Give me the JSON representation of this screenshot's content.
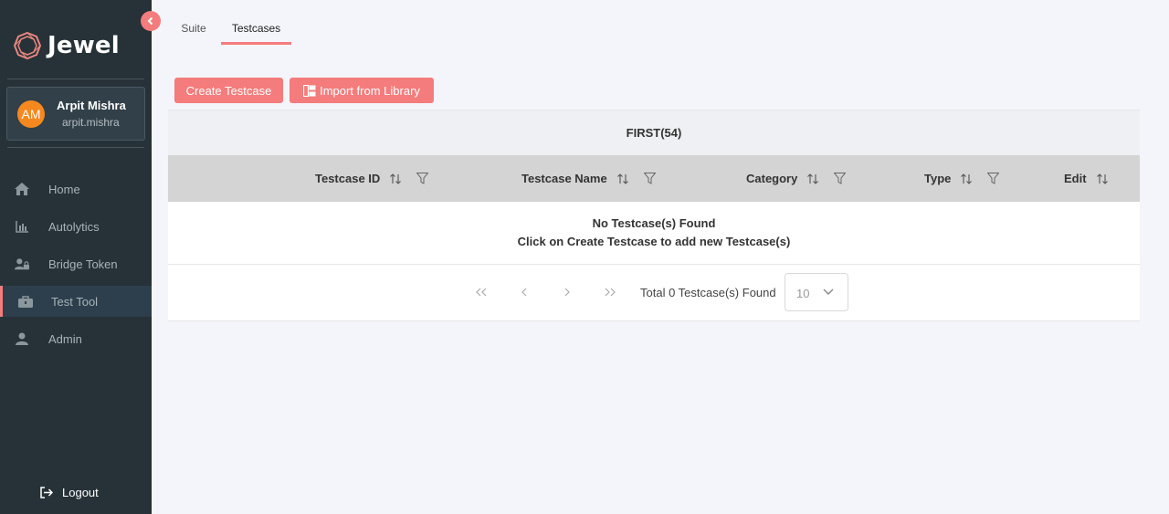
{
  "app": {
    "name": "Jewel",
    "accent": "#f47c7c",
    "sidebar_bg": "#263238"
  },
  "user": {
    "initials": "AM",
    "name": "Arpit Mishra",
    "handle": "arpit.mishra"
  },
  "nav": [
    {
      "label": "Home",
      "icon": "home-icon",
      "active": false
    },
    {
      "label": "Autolytics",
      "icon": "bar-chart-icon",
      "active": false
    },
    {
      "label": "Bridge Token",
      "icon": "user-lock-icon",
      "active": false
    },
    {
      "label": "Test Tool",
      "icon": "toolbox-icon",
      "active": true
    },
    {
      "label": "Admin",
      "icon": "user-icon",
      "active": false
    }
  ],
  "logout_label": "Logout",
  "tabs": [
    {
      "label": "Suite",
      "active": false
    },
    {
      "label": "Testcases",
      "active": true
    }
  ],
  "actions": {
    "create": "Create Testcase",
    "import": "Import from Library"
  },
  "table": {
    "group_title": "FIRST(54)",
    "columns": [
      "Testcase ID",
      "Testcase Name",
      "Category",
      "Type",
      "Edit"
    ],
    "empty_line1": "No Testcase(s) Found",
    "empty_line2": "Click on Create Testcase to add new Testcase(s)"
  },
  "pagination": {
    "total_text": "Total 0 Testcase(s) Found",
    "page_size": "10"
  }
}
